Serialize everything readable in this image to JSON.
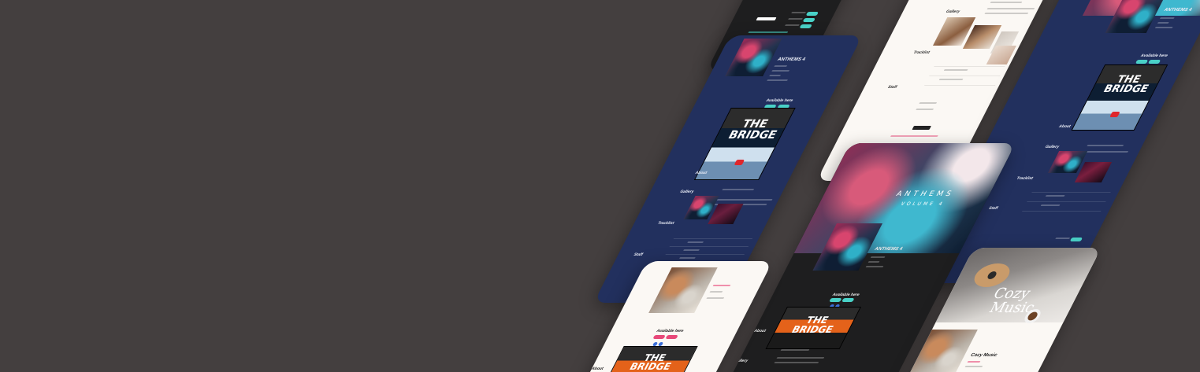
{
  "screens": {
    "navy_a": {
      "album_title": "ANTHEMS 4",
      "available_label": "Available here",
      "video_title_1": "THE",
      "video_title_2": "BRIDGE",
      "about_label": "About",
      "gallery_label": "Gallery",
      "tracklist_label": "Tracklist",
      "staff_label": "Staff"
    },
    "navy_b": {
      "album_title": "ANTHEMS 4",
      "available_label": "Available here",
      "video_title_1": "THE",
      "video_title_2": "BRIDGE",
      "about_label": "About",
      "gallery_label": "Gallery",
      "tracklist_label": "Tracklist",
      "staff_label": "Staff"
    },
    "light_top": {
      "gallery_label": "Gallery",
      "tracklist_label": "Tracklist",
      "staff_label": "Staff"
    },
    "dark_center": {
      "hero_title": "ANTHEMS",
      "hero_sub": "VOLUME 4",
      "album_title": "ANTHEMS 4",
      "available_label": "Available here",
      "video_title_1": "THE",
      "video_title_2": "BRIDGE",
      "about_label": "About",
      "gallery_label": "Gallery"
    },
    "light_bottom": {
      "available_label": "Available here",
      "video_title_1": "THE",
      "video_title_2": "BRIDGE",
      "about_label": "About"
    },
    "cozy": {
      "hero_title_1": "Cozy",
      "hero_title_2": "Music",
      "album_title": "Cozy Music"
    }
  },
  "colors": {
    "background": "#443f3f",
    "navy": "#22305e",
    "dark": "#1e1e1f",
    "light": "#fbf8f4",
    "accent_teal": "#49d1c7",
    "accent_pink": "#e8497a"
  }
}
